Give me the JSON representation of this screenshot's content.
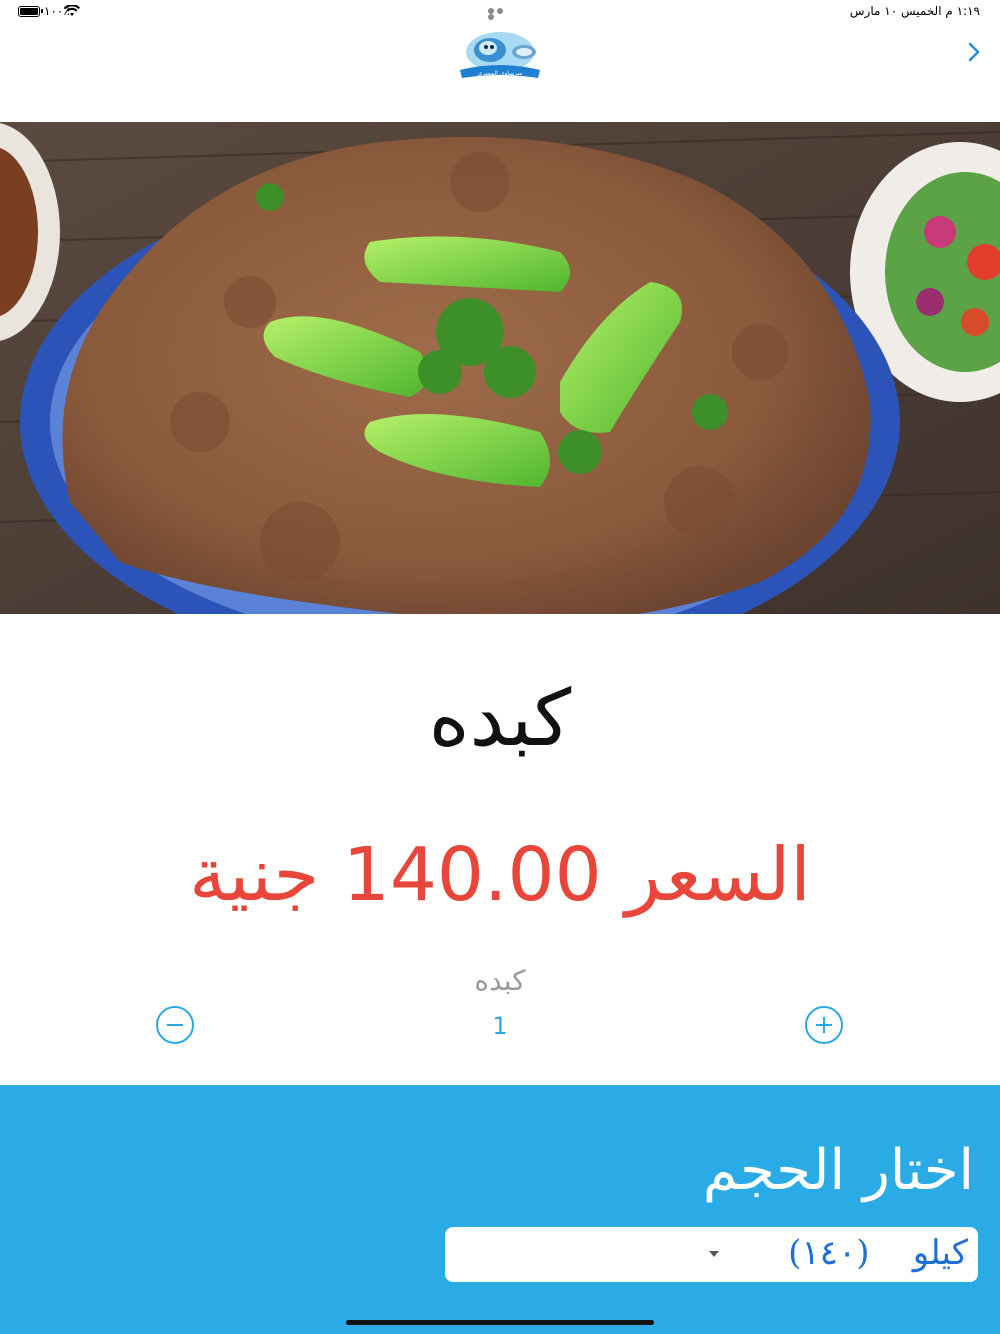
{
  "status_bar": {
    "time": "١:١٩ م   الخميس ١٠ مارس",
    "battery": "٪١٠٠"
  },
  "nav": {
    "logo_text": "سرساوي المسري"
  },
  "product": {
    "title": "كبده",
    "price": "السعر 140.00 جنية"
  },
  "quantity": {
    "label": "كبده",
    "value": "1"
  },
  "size": {
    "heading": "اختار الحجم",
    "selected_option": "كيلو    (١٤٠)"
  },
  "colors": {
    "accent": "#2babe5",
    "price": "#e8463a",
    "select_text": "#1e6fd6"
  }
}
